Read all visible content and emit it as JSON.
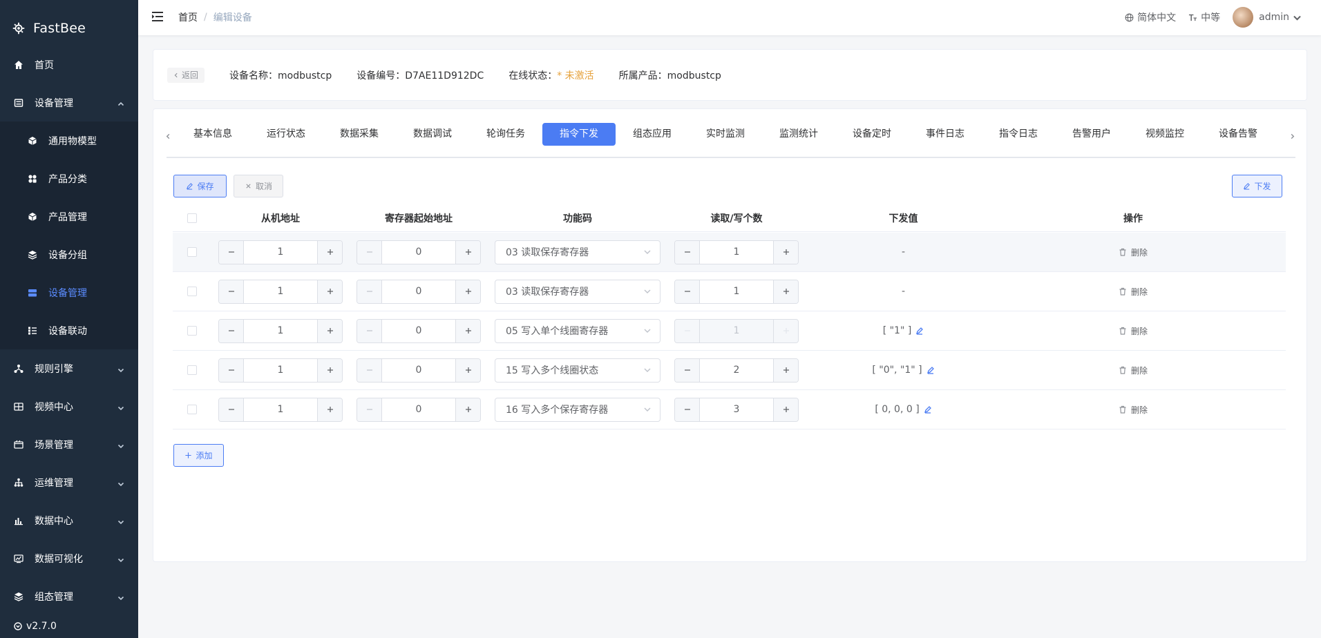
{
  "sidebar": {
    "logo_text": "FastBee",
    "items": [
      {
        "label": "首页",
        "icon": "home-icon"
      },
      {
        "label": "设备管理",
        "icon": "device-icon",
        "expanded": true
      },
      {
        "label": "通用物模型",
        "icon": "cube-icon"
      },
      {
        "label": "产品分类",
        "icon": "category-icon"
      },
      {
        "label": "产品管理",
        "icon": "product-icon"
      },
      {
        "label": "设备分组",
        "icon": "group-icon"
      },
      {
        "label": "设备管理",
        "icon": "device-manage-icon",
        "active": true
      },
      {
        "label": "设备联动",
        "icon": "link-icon"
      },
      {
        "label": "规则引擎",
        "icon": "rule-icon"
      },
      {
        "label": "视频中心",
        "icon": "video-icon"
      },
      {
        "label": "场景管理",
        "icon": "scene-icon"
      },
      {
        "label": "运维管理",
        "icon": "ops-icon"
      },
      {
        "label": "数据中心",
        "icon": "chart-icon"
      },
      {
        "label": "数据可视化",
        "icon": "visual-icon"
      },
      {
        "label": "组态管理",
        "icon": "layers-icon"
      }
    ],
    "version": "v2.7.0"
  },
  "header": {
    "breadcrumb": [
      "首页",
      "编辑设备"
    ],
    "lang": "简体中文",
    "size": "中等",
    "user": "admin"
  },
  "info": {
    "back": "返回",
    "device_name_label": "设备名称：",
    "device_name": "modbustcp",
    "device_no_label": "设备编号：",
    "device_no": "D7AE11D912DC",
    "status_label": "在线状态：",
    "status": "* 未激活",
    "product_label": "所属产品：",
    "product": "modbustcp"
  },
  "tabs": [
    "基本信息",
    "运行状态",
    "数据采集",
    "数据调试",
    "轮询任务",
    "指令下发",
    "组态应用",
    "实时监测",
    "监测统计",
    "设备定时",
    "事件日志",
    "指令日志",
    "告警用户",
    "视频监控",
    "设备告警"
  ],
  "active_tab": "指令下发",
  "toolbar": {
    "save": "保存",
    "cancel": "取消",
    "send": "下发",
    "add": "添加"
  },
  "table": {
    "headers": [
      "从机地址",
      "寄存器起始地址",
      "功能码",
      "读取/写个数",
      "下发值",
      "操作"
    ],
    "rows": [
      {
        "slave": "1",
        "start": "0",
        "func": "03 读取保存寄存器",
        "count": "1",
        "value": "-",
        "editable": false,
        "count_disabled": false,
        "action": "删除"
      },
      {
        "slave": "1",
        "start": "0",
        "func": "03 读取保存寄存器",
        "count": "1",
        "value": "-",
        "editable": false,
        "count_disabled": false,
        "action": "删除"
      },
      {
        "slave": "1",
        "start": "0",
        "func": "05 写入单个线圈寄存器",
        "count": "1",
        "value": "[ \"1\" ]",
        "editable": true,
        "count_disabled": true,
        "action": "删除"
      },
      {
        "slave": "1",
        "start": "0",
        "func": "15 写入多个线圈状态",
        "count": "2",
        "value": "[ \"0\", \"1\" ]",
        "editable": true,
        "count_disabled": false,
        "action": "删除"
      },
      {
        "slave": "1",
        "start": "0",
        "func": "16 写入多个保存寄存器",
        "count": "3",
        "value": "[ 0, 0, 0 ]",
        "editable": true,
        "count_disabled": false,
        "action": "删除"
      }
    ]
  },
  "colors": {
    "accent": "#4b7cf3",
    "sidebar": "#1f2d3d",
    "warning": "#e6a23c"
  }
}
